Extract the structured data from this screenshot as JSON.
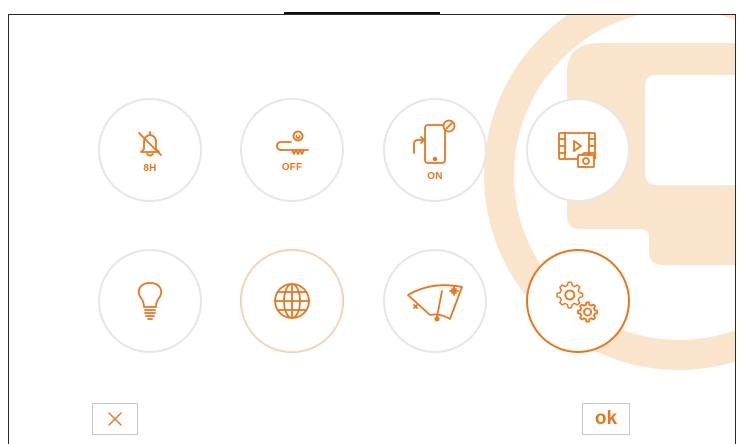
{
  "theme": {
    "accent": "#e8761e",
    "tile_border": "#e6e6e6",
    "watermark": "#fbe4cc"
  },
  "tiles": [
    {
      "icon": "bell-off-icon",
      "label": "8H"
    },
    {
      "icon": "key-icon",
      "label": "OFF"
    },
    {
      "icon": "phone-forward-icon",
      "label": "ON"
    },
    {
      "icon": "video-gallery-icon",
      "label": ""
    },
    {
      "icon": "lightbulb-icon",
      "label": ""
    },
    {
      "icon": "globe-icon",
      "label": ""
    },
    {
      "icon": "wiper-icon",
      "label": ""
    },
    {
      "icon": "settings-gears-icon",
      "label": ""
    }
  ],
  "footer": {
    "cancel_icon": "close-icon",
    "ok_label": "ok"
  }
}
